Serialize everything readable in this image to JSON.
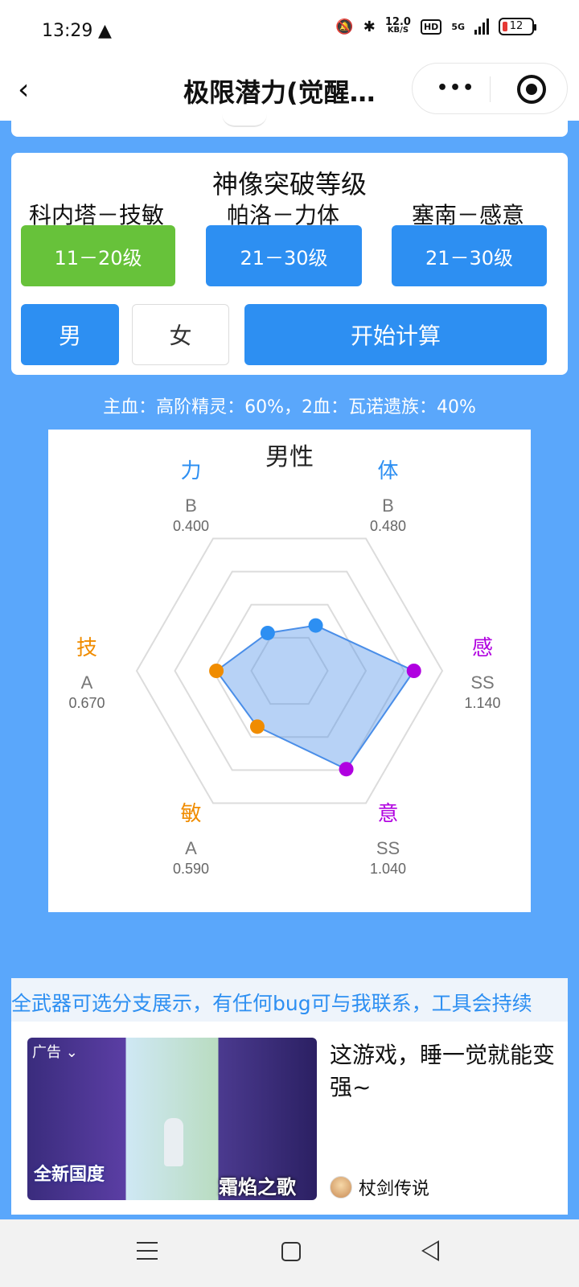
{
  "status_bar": {
    "time": "13:29",
    "net_speed": "12.0",
    "net_unit": "KB/S",
    "hd": "HD",
    "network": "5G",
    "battery": "12"
  },
  "header": {
    "title": "极限潜力(觉醒…"
  },
  "config": {
    "heading": "神像突破等级",
    "slots": [
      {
        "label": "科内塔－技敏",
        "level": "11－20级",
        "color": "#67c23a"
      },
      {
        "label": "帕洛－力体",
        "level": "21－30级",
        "color": "#2d8ff2"
      },
      {
        "label": "塞南－感意",
        "level": "21－30级",
        "color": "#2d8ff2"
      }
    ],
    "male": "男",
    "female": "女",
    "start": "开始计算"
  },
  "bloodline": "主血：高阶精灵：60%，2血：瓦诺遗族：40%",
  "chart_data": {
    "type": "radar",
    "title": "男性",
    "axes": [
      {
        "name": "力",
        "grade": "B",
        "value": 0.4,
        "label": "0.400",
        "color": "#2d8ff2"
      },
      {
        "name": "体",
        "grade": "B",
        "value": 0.48,
        "label": "0.480",
        "color": "#2d8ff2"
      },
      {
        "name": "感",
        "grade": "SS",
        "value": 1.14,
        "label": "1.140",
        "color": "#b000e0"
      },
      {
        "name": "意",
        "grade": "SS",
        "value": 1.04,
        "label": "1.040",
        "color": "#b000e0"
      },
      {
        "name": "敏",
        "grade": "A",
        "value": 0.59,
        "label": "0.590",
        "color": "#f08c00"
      },
      {
        "name": "技",
        "grade": "A",
        "value": 0.67,
        "label": "0.670",
        "color": "#f08c00"
      }
    ],
    "max": 1.4,
    "rings": 4,
    "fill": "#4a8ee8"
  },
  "marquee": "全武器可选分支展示，有任何bug可与我联系，工具会持续",
  "ad": {
    "tag": "广告 ⌄",
    "img_text_left": "全新国度",
    "img_text_right": "霜焰之歌",
    "headline": "这游戏，睡一觉就能变强~",
    "source": "杖剑传说"
  }
}
